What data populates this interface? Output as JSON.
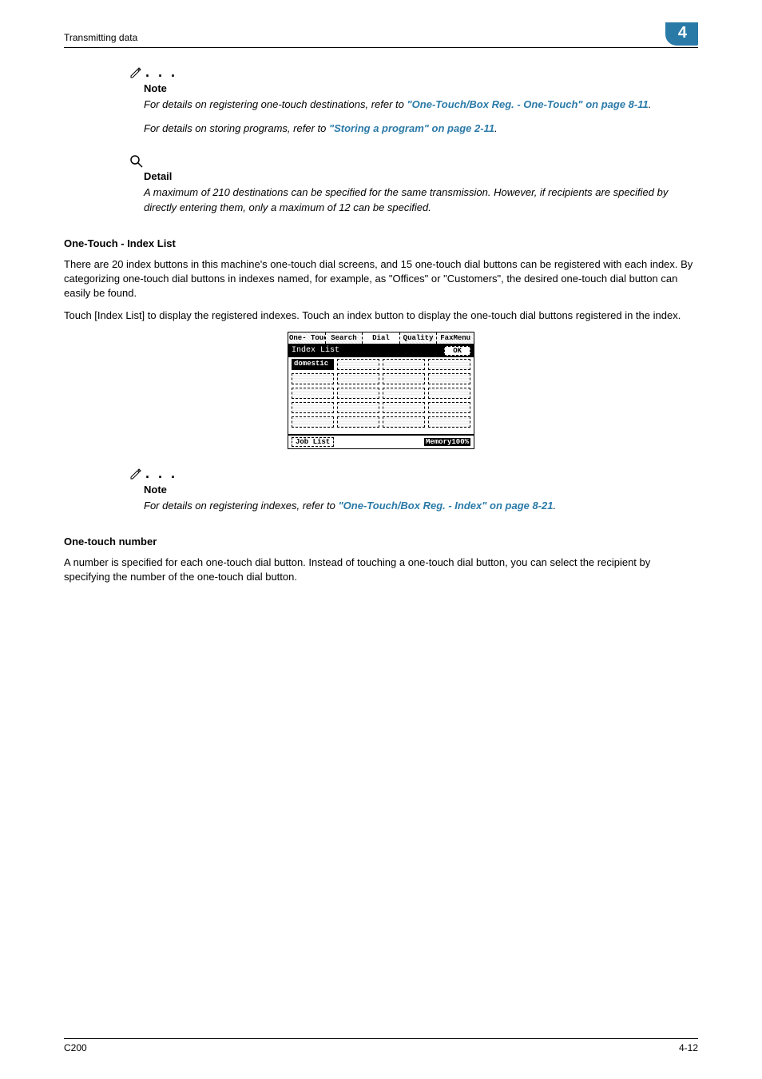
{
  "header": {
    "section": "Transmitting data",
    "chapter": "4"
  },
  "note1": {
    "title": "Note",
    "line1_pre": "For details on registering one-touch destinations, refer to ",
    "line1_link": "\"One-Touch/Box Reg. - One-Touch\" on page 8-11",
    "line1_post": ".",
    "line2_pre": "For details on storing programs, refer to ",
    "line2_link": "\"Storing a program\" on page 2-11",
    "line2_post": "."
  },
  "detail": {
    "title": "Detail",
    "body": "A maximum of 210 destinations can be specified for the same transmission. However, if recipients are specified by directly entering them, only a maximum of 12 can be specified."
  },
  "section_index": {
    "heading": "One-Touch - Index List",
    "para1": "There are 20 index buttons in this machine's one-touch dial screens, and 15 one-touch dial buttons can be registered with each index. By categorizing one-touch dial buttons in indexes named, for example, as \"Offices\" or \"Customers\", the desired one-touch dial button can easily be found.",
    "para2": "Touch [Index List] to display the registered indexes. Touch an index button to display the one-touch dial buttons registered in the index."
  },
  "panel": {
    "tabs": [
      "One-\nTouch",
      "Search",
      "Dial",
      "Quality",
      "FaxMenu"
    ],
    "title": "Index List",
    "ok": "OK",
    "selected": "domestic",
    "joblist": "Job List",
    "memory": "Memory100%"
  },
  "note2": {
    "title": "Note",
    "pre": "For details on registering indexes, refer to ",
    "link": "\"One-Touch/Box Reg. - Index\" on page 8-21",
    "post": "."
  },
  "section_number": {
    "heading": "One-touch number",
    "para": "A number is specified for each one-touch dial button. Instead of touching a one-touch dial button, you can select the recipient by specifying the number of the one-touch dial button."
  },
  "footer": {
    "left": "C200",
    "right": "4-12"
  }
}
